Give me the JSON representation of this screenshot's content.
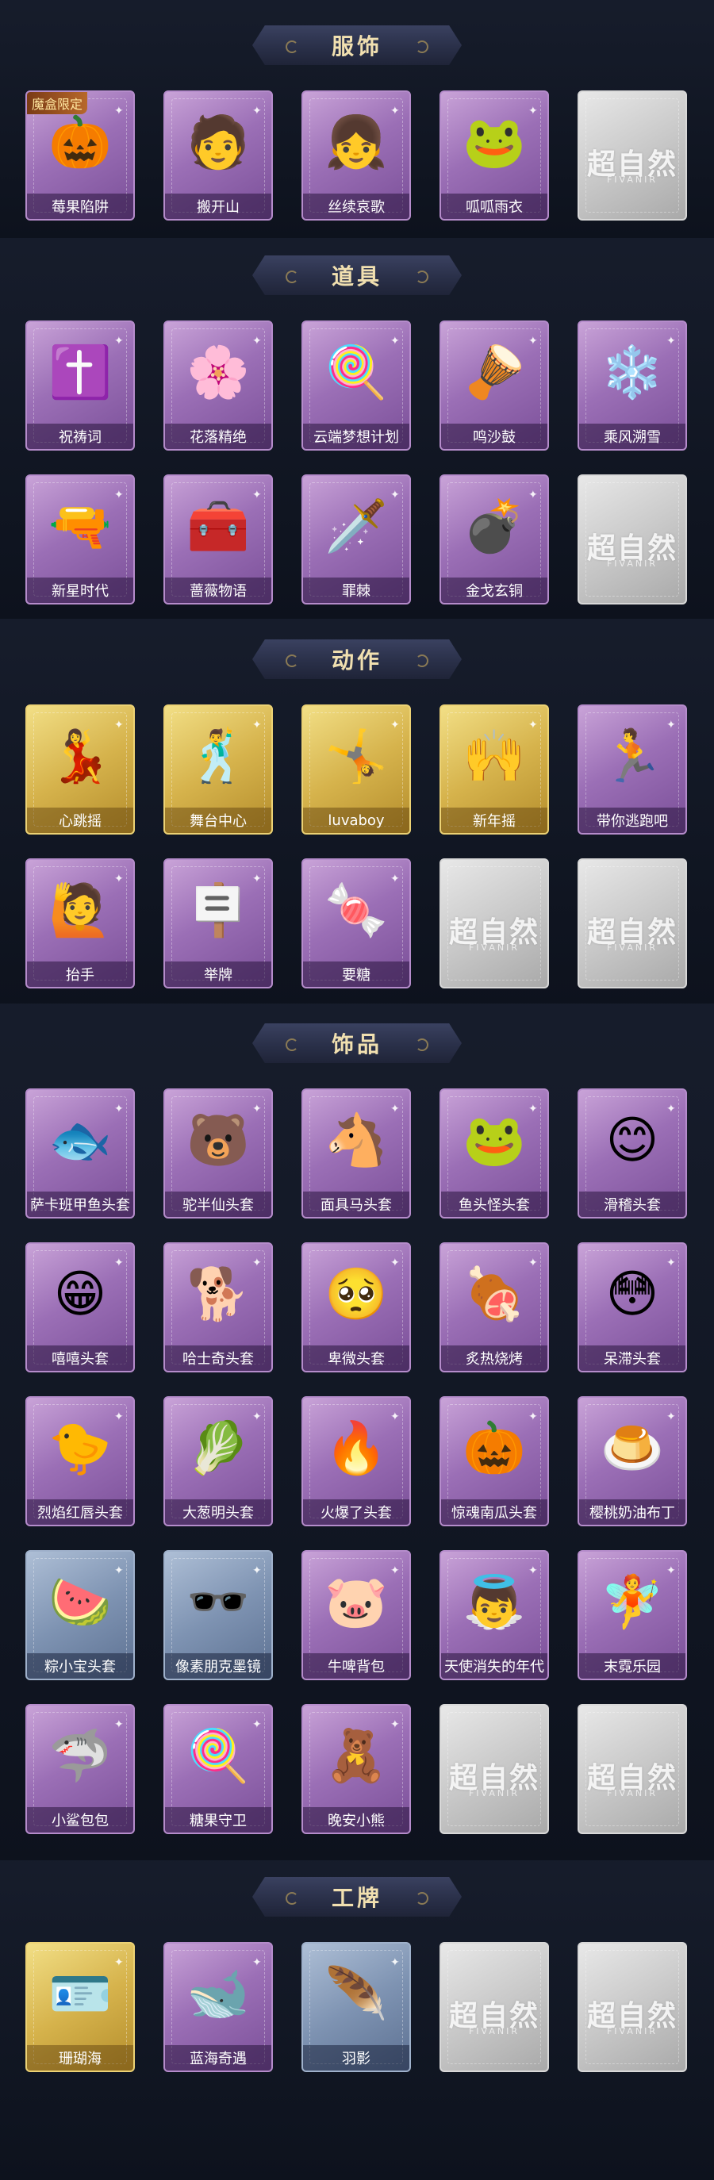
{
  "sections": [
    {
      "title": "服饰",
      "rows": [
        [
          {
            "label": "莓果陷阱",
            "style": "purple",
            "icon": "🎃",
            "badge": "魔盒限定"
          },
          {
            "label": "搬开山",
            "style": "purple",
            "icon": "🧑"
          },
          {
            "label": "丝续哀歌",
            "style": "purple",
            "icon": "👧"
          },
          {
            "label": "呱呱雨衣",
            "style": "purple",
            "icon": "🐸"
          },
          {
            "label": "",
            "style": "grey",
            "placeholder": "超自然"
          }
        ]
      ]
    },
    {
      "title": "道具",
      "rows": [
        [
          {
            "label": "祝祷词",
            "style": "purple",
            "icon": "✝️"
          },
          {
            "label": "花落精绝",
            "style": "purple",
            "icon": "🌸"
          },
          {
            "label": "云端梦想计划",
            "style": "purple",
            "icon": "🍭"
          },
          {
            "label": "鸣沙鼓",
            "style": "purple",
            "icon": "🪘"
          },
          {
            "label": "乘风溯雪",
            "style": "purple",
            "icon": "❄️"
          }
        ],
        [
          {
            "label": "新星时代",
            "style": "purple",
            "icon": "🔫"
          },
          {
            "label": "蔷薇物语",
            "style": "purple",
            "icon": "🧰"
          },
          {
            "label": "罪棘",
            "style": "purple",
            "icon": "🗡️"
          },
          {
            "label": "金戈玄铜",
            "style": "purple",
            "icon": "💣"
          },
          {
            "label": "",
            "style": "grey",
            "placeholder": "超自然"
          }
        ]
      ]
    },
    {
      "title": "动作",
      "rows": [
        [
          {
            "label": "心跳摇",
            "style": "gold",
            "icon": "💃"
          },
          {
            "label": "舞台中心",
            "style": "gold",
            "icon": "🕺"
          },
          {
            "label": "luvaboy",
            "style": "gold",
            "icon": "🤸"
          },
          {
            "label": "新年摇",
            "style": "gold",
            "icon": "🙌"
          },
          {
            "label": "带你逃跑吧",
            "style": "purple",
            "icon": "🏃"
          }
        ],
        [
          {
            "label": "抬手",
            "style": "purple",
            "icon": "🙋"
          },
          {
            "label": "举牌",
            "style": "purple",
            "icon": "🪧"
          },
          {
            "label": "要糖",
            "style": "purple",
            "icon": "🍬"
          },
          {
            "label": "",
            "style": "grey",
            "placeholder": "超自然"
          },
          {
            "label": "",
            "style": "grey",
            "placeholder": "超自然"
          }
        ]
      ]
    },
    {
      "title": "饰品",
      "rows": [
        [
          {
            "label": "萨卡班甲鱼头套",
            "style": "purple",
            "icon": "🐟"
          },
          {
            "label": "驼半仙头套",
            "style": "purple",
            "icon": "🐻"
          },
          {
            "label": "面具马头套",
            "style": "purple",
            "icon": "🐴"
          },
          {
            "label": "鱼头怪头套",
            "style": "purple",
            "icon": "🐸"
          },
          {
            "label": "滑稽头套",
            "style": "purple",
            "icon": "😊"
          }
        ],
        [
          {
            "label": "嘻嘻头套",
            "style": "purple",
            "icon": "😁"
          },
          {
            "label": "哈士奇头套",
            "style": "purple",
            "icon": "🐕"
          },
          {
            "label": "卑微头套",
            "style": "purple",
            "icon": "🥺"
          },
          {
            "label": "炙热烧烤",
            "style": "purple",
            "icon": "🍖"
          },
          {
            "label": "呆滞头套",
            "style": "purple",
            "icon": "😳"
          }
        ],
        [
          {
            "label": "烈焰红唇头套",
            "style": "purple",
            "icon": "🐤"
          },
          {
            "label": "大葱明头套",
            "style": "purple",
            "icon": "🥬"
          },
          {
            "label": "火爆了头套",
            "style": "purple",
            "icon": "🔥"
          },
          {
            "label": "惊魂南瓜头套",
            "style": "purple",
            "icon": "🎃"
          },
          {
            "label": "樱桃奶油布丁",
            "style": "purple",
            "icon": "🍮"
          }
        ],
        [
          {
            "label": "粽小宝头套",
            "style": "blue",
            "icon": "🍉"
          },
          {
            "label": "像素朋克墨镜",
            "style": "blue",
            "icon": "🕶️"
          },
          {
            "label": "牛啤背包",
            "style": "purple",
            "icon": "🐷"
          },
          {
            "label": "天使消失的年代",
            "style": "purple",
            "icon": "👼"
          },
          {
            "label": "末霓乐园",
            "style": "purple",
            "icon": "🧚"
          }
        ],
        [
          {
            "label": "小鲨包包",
            "style": "purple",
            "icon": "🦈"
          },
          {
            "label": "糖果守卫",
            "style": "purple",
            "icon": "🍭"
          },
          {
            "label": "晚安小熊",
            "style": "purple",
            "icon": "🧸"
          },
          {
            "label": "",
            "style": "grey",
            "placeholder": "超自然"
          },
          {
            "label": "",
            "style": "grey",
            "placeholder": "超自然"
          }
        ]
      ]
    },
    {
      "title": "工牌",
      "rows": [
        [
          {
            "label": "珊瑚海",
            "style": "gold",
            "icon": "🪪"
          },
          {
            "label": "蓝海奇遇",
            "style": "purple",
            "icon": "🐋"
          },
          {
            "label": "羽影",
            "style": "blue",
            "icon": "🪶"
          },
          {
            "label": "",
            "style": "grey",
            "placeholder": "超自然"
          },
          {
            "label": "",
            "style": "grey",
            "placeholder": "超自然"
          }
        ]
      ]
    }
  ],
  "placeholder_sub": "FIVANIR"
}
